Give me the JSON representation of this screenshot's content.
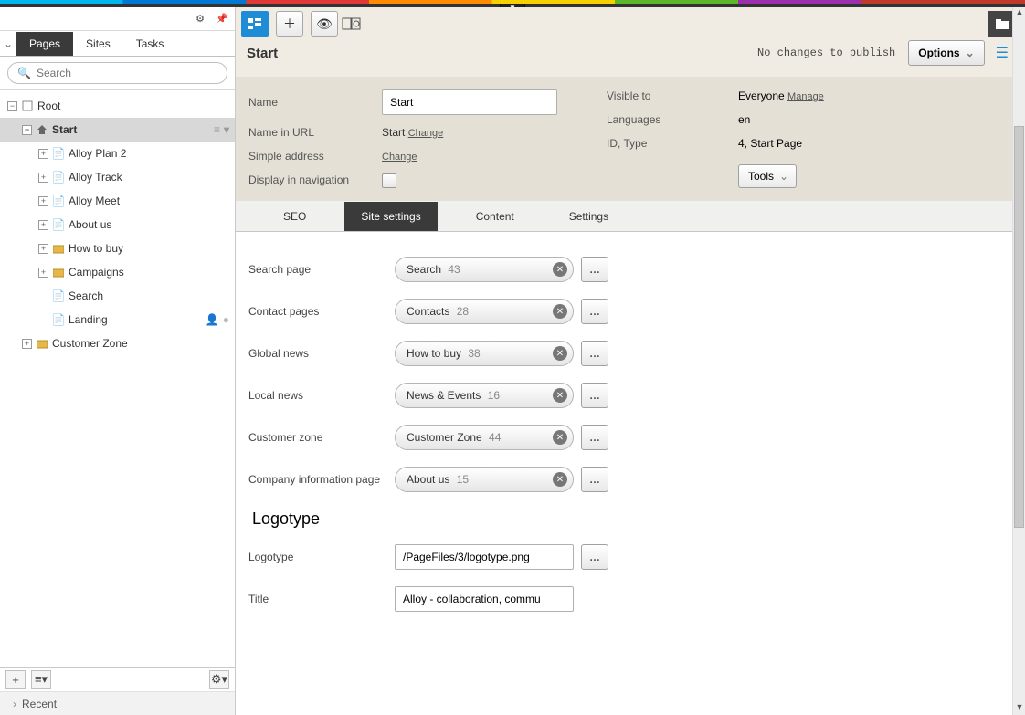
{
  "tabs_left": {
    "pages": "Pages",
    "sites": "Sites",
    "tasks": "Tasks"
  },
  "search_placeholder": "Search",
  "tree": {
    "root": "Root",
    "start": "Start",
    "n1": "Alloy Plan 2",
    "n2": "Alloy Track",
    "n3": "Alloy Meet",
    "n4": "About us",
    "n5": "How to buy",
    "n6": "Campaigns",
    "n7": "Search",
    "n8": "Landing",
    "cz": "Customer Zone"
  },
  "recent": "Recent",
  "page_title": "Start",
  "publish_status": "No changes to publish",
  "options_label": "Options",
  "hdr": {
    "name_label": "Name",
    "name_value": "Start",
    "name_url_label": "Name in URL",
    "name_url_value": "Start",
    "change": "Change",
    "simple_addr_label": "Simple address",
    "display_nav_label": "Display in navigation",
    "visible_label": "Visible to",
    "visible_value": "Everyone",
    "manage": "Manage",
    "lang_label": "Languages",
    "lang_value": "en",
    "idtype_label": "ID, Type",
    "idtype_value": "4, Start Page",
    "tools": "Tools"
  },
  "tabs2": {
    "seo": "SEO",
    "site": "Site settings",
    "content": "Content",
    "settings": "Settings"
  },
  "fields": [
    {
      "label": "Search page",
      "chip": "Search",
      "id": "43"
    },
    {
      "label": "Contact pages",
      "chip": "Contacts",
      "id": "28"
    },
    {
      "label": "Global news",
      "chip": "How to buy",
      "id": "38"
    },
    {
      "label": "Local news",
      "chip": "News & Events",
      "id": "16"
    },
    {
      "label": "Customer zone",
      "chip": "Customer Zone",
      "id": "44"
    },
    {
      "label": "Company information page",
      "chip": "About us",
      "id": "15"
    }
  ],
  "logotype_section": "Logotype",
  "logotype_label": "Logotype",
  "logotype_value": "/PageFiles/3/logotype.png",
  "title_label": "Title",
  "title_value": "Alloy - collaboration, commu"
}
